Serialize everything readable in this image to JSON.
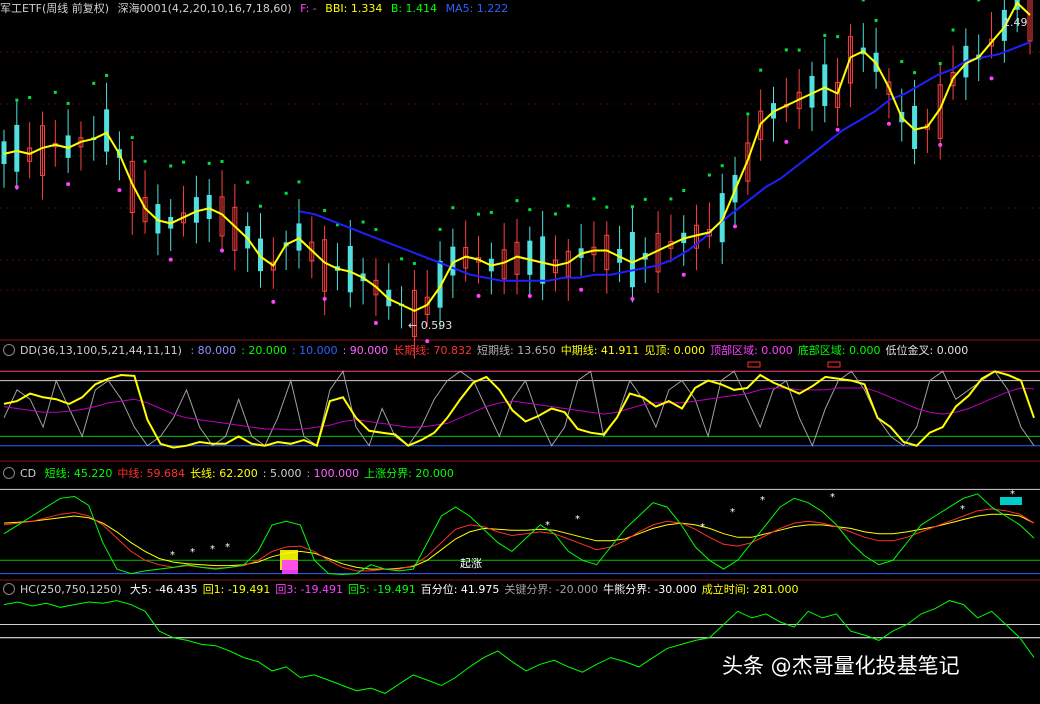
{
  "main": {
    "title": "军工ETF(周线 前复权)",
    "indicator": "深海0001(4,2,20,10,16,7,18,60)",
    "f": "F: -",
    "bbi": "BBI: 1.334",
    "b": "B: 1.414",
    "ma5": "MA5: 1.222",
    "high_label": "1.49",
    "low_label": "0.593"
  },
  "dd": {
    "name": "DD(36,13,100,5,21,44,11,11)",
    "items": [
      {
        "text": ": 80.000",
        "color": "#9090ff"
      },
      {
        "text": ": 20.000",
        "color": "#00ff00"
      },
      {
        "text": ": 10.000",
        "color": "#3060ff"
      },
      {
        "text": ": 90.000",
        "color": "#ff60ff"
      },
      {
        "text": "长期线: 70.832",
        "color": "#ff3030"
      },
      {
        "text": "短期线: 13.650",
        "color": "#b0b0b0"
      },
      {
        "text": "中期线: 41.911",
        "color": "#ffff00"
      },
      {
        "text": "见顶: 0.000",
        "color": "#ffff00"
      },
      {
        "text": "顶部区域: 0.000",
        "color": "#ff40ff"
      },
      {
        "text": "底部区域: 0.000",
        "color": "#00ff00"
      },
      {
        "text": "低位金叉: 0.000",
        "color": "#e0e0e0"
      }
    ]
  },
  "cd": {
    "name": "CD",
    "items": [
      {
        "text": "短线: 45.220",
        "color": "#00ff00"
      },
      {
        "text": "中线: 59.684",
        "color": "#ff3030"
      },
      {
        "text": "长线: 62.200",
        "color": "#ffff00"
      },
      {
        "text": ": 5.000",
        "color": "#d0d0d0"
      },
      {
        "text": ": 100.000",
        "color": "#ff60ff"
      },
      {
        "text": "上涨分界: 20.000",
        "color": "#00ff00"
      }
    ],
    "label": "起涨"
  },
  "hc": {
    "name": "HC(250,750,1250)",
    "items": [
      {
        "text": "大5: -46.435",
        "color": "#ffffff"
      },
      {
        "text": "回1: -19.491",
        "color": "#ffff00"
      },
      {
        "text": "回3: -19.491",
        "color": "#ff40ff"
      },
      {
        "text": "回5: -19.491",
        "color": "#00ff00"
      },
      {
        "text": "百分位: 41.975",
        "color": "#ffffff"
      },
      {
        "text": "关键分界: -20.000",
        "color": "#a0a0a0"
      },
      {
        "text": "牛熊分界: -30.000",
        "color": "#ffffff"
      },
      {
        "text": "成立时间: 281.000",
        "color": "#ffff00"
      }
    ]
  },
  "watermark": "头条 @杰哥量化投基笔记",
  "chart_data": [
    {
      "type": "line",
      "title": "军工ETF(周线 前复权)",
      "series": [
        {
          "name": "BBI",
          "color": "#ffff00",
          "values": [
            1.1,
            1.11,
            1.1,
            1.12,
            1.13,
            1.12,
            1.14,
            1.15,
            1.17,
            1.1,
            1.0,
            0.92,
            0.88,
            0.87,
            0.89,
            0.91,
            0.92,
            0.9,
            0.86,
            0.82,
            0.76,
            0.73,
            0.8,
            0.82,
            0.78,
            0.74,
            0.72,
            0.71,
            0.69,
            0.66,
            0.62,
            0.6,
            0.58,
            0.6,
            0.66,
            0.74,
            0.76,
            0.75,
            0.73,
            0.74,
            0.76,
            0.75,
            0.74,
            0.73,
            0.74,
            0.77,
            0.78,
            0.78,
            0.76,
            0.74,
            0.76,
            0.78,
            0.8,
            0.82,
            0.83,
            0.84,
            0.88,
            0.98,
            1.08,
            1.2,
            1.24,
            1.26,
            1.28,
            1.3,
            1.32,
            1.3,
            1.42,
            1.44,
            1.4,
            1.32,
            1.22,
            1.18,
            1.19,
            1.25,
            1.35,
            1.4,
            1.42,
            1.47,
            1.52,
            1.6,
            1.56
          ]
        },
        {
          "name": "B",
          "color": "#2020ff",
          "values": [
            null,
            null,
            null,
            null,
            null,
            null,
            null,
            null,
            null,
            null,
            null,
            null,
            null,
            null,
            null,
            null,
            null,
            null,
            null,
            0.91,
            0.9,
            0.88,
            0.86,
            0.84,
            0.82,
            0.8,
            0.78,
            0.76,
            0.74,
            0.72,
            0.7,
            0.69,
            0.68,
            0.68,
            0.68,
            0.68,
            0.69,
            0.69,
            0.7,
            0.7,
            0.71,
            0.72,
            0.73,
            0.75,
            0.78,
            0.82,
            0.87,
            0.91,
            0.95,
            0.99,
            1.02,
            1.06,
            1.1,
            1.14,
            1.18,
            1.21,
            1.24,
            1.28,
            1.3,
            1.33,
            1.36,
            1.38,
            1.41,
            1.42,
            1.43,
            1.45,
            1.47
          ]
        }
      ],
      "low": 0.593,
      "high": 1.49
    },
    {
      "type": "line",
      "title": "DD(36,13,100,5,21,44,11,11)",
      "reference_lines": [
        80,
        90,
        20,
        10
      ],
      "series": [
        {
          "name": "中期线",
          "color": "#ffff00",
          "values": [
            55,
            58,
            66,
            62,
            60,
            55,
            62,
            76,
            82,
            86,
            85,
            38,
            12,
            8,
            10,
            14,
            12,
            12,
            20,
            12,
            10,
            14,
            12,
            16,
            10,
            58,
            62,
            40,
            26,
            24,
            22,
            10,
            16,
            24,
            40,
            60,
            78,
            84,
            70,
            48,
            36,
            42,
            50,
            46,
            28,
            24,
            22,
            40,
            66,
            62,
            52,
            58,
            50,
            72,
            80,
            76,
            70,
            72,
            86,
            78,
            72,
            66,
            74,
            84,
            82,
            80,
            76,
            40,
            30,
            14,
            10,
            24,
            30,
            52,
            64,
            82,
            90,
            86,
            80,
            40
          ]
        },
        {
          "name": "长期线",
          "color": "#c000c0",
          "values": [
            52,
            50,
            48,
            46,
            46,
            47,
            49,
            52,
            56,
            58,
            60,
            56,
            50,
            44,
            40,
            38,
            36,
            34,
            32,
            30,
            28,
            28,
            27,
            28,
            30,
            32,
            36,
            38,
            36,
            34,
            32,
            30,
            30,
            32,
            34,
            40,
            46,
            52,
            56,
            58,
            56,
            54,
            52,
            50,
            48,
            46,
            44,
            46,
            50,
            54,
            56,
            56,
            56,
            58,
            60,
            62,
            64,
            66,
            70,
            72,
            72,
            70,
            70,
            70,
            72,
            72,
            72,
            68,
            62,
            56,
            50,
            46,
            44,
            46,
            50,
            56,
            62,
            68,
            72,
            71
          ]
        },
        {
          "name": "短期线",
          "color": "#a0a0a0",
          "values": [
            40,
            70,
            60,
            30,
            80,
            50,
            20,
            70,
            80,
            60,
            30,
            10,
            20,
            40,
            70,
            30,
            10,
            20,
            60,
            20,
            10,
            40,
            80,
            20,
            10,
            70,
            90,
            30,
            10,
            50,
            20,
            10,
            30,
            60,
            80,
            90,
            80,
            50,
            20,
            60,
            80,
            40,
            10,
            30,
            80,
            90,
            20,
            40,
            80,
            60,
            30,
            70,
            80,
            60,
            20,
            80,
            90,
            60,
            30,
            70,
            80,
            40,
            10,
            50,
            80,
            90,
            70,
            40,
            20,
            10,
            30,
            80,
            90,
            60,
            70,
            80,
            90,
            70,
            30,
            10
          ]
        }
      ]
    },
    {
      "type": "line",
      "title": "CD",
      "reference_lines": [
        100,
        20,
        5
      ],
      "series": [
        {
          "name": "短线",
          "color": "#00ff00",
          "values": [
            50,
            60,
            70,
            80,
            90,
            92,
            82,
            40,
            10,
            5,
            8,
            10,
            12,
            15,
            12,
            10,
            12,
            15,
            30,
            60,
            64,
            60,
            20,
            5,
            4,
            5,
            15,
            10,
            8,
            10,
            40,
            70,
            80,
            70,
            55,
            40,
            30,
            45,
            60,
            50,
            30,
            20,
            15,
            35,
            55,
            70,
            85,
            80,
            60,
            35,
            20,
            10,
            20,
            40,
            60,
            80,
            90,
            85,
            75,
            60,
            40,
            25,
            15,
            20,
            40,
            60,
            70,
            80,
            90,
            95,
            80,
            70,
            60,
            45
          ]
        },
        {
          "name": "中线",
          "color": "#ff3030",
          "values": [
            60,
            62,
            64,
            68,
            72,
            74,
            70,
            60,
            45,
            30,
            20,
            15,
            12,
            14,
            12,
            11,
            12,
            14,
            20,
            30,
            35,
            36,
            30,
            20,
            12,
            8,
            8,
            10,
            10,
            14,
            25,
            40,
            55,
            60,
            58,
            52,
            48,
            50,
            52,
            50,
            44,
            38,
            32,
            35,
            42,
            52,
            60,
            64,
            62,
            55,
            46,
            38,
            36,
            40,
            48,
            56,
            62,
            64,
            62,
            58,
            52,
            46,
            42,
            42,
            46,
            52,
            58,
            64,
            70,
            76,
            78,
            76,
            72,
            62
          ]
        },
        {
          "name": "长线",
          "color": "#ffff00",
          "values": [
            62,
            63,
            64,
            66,
            68,
            70,
            68,
            62,
            52,
            40,
            30,
            22,
            18,
            16,
            15,
            14,
            14,
            15,
            18,
            24,
            28,
            30,
            28,
            22,
            16,
            12,
            10,
            10,
            11,
            13,
            20,
            32,
            44,
            52,
            56,
            55,
            54,
            54,
            55,
            54,
            50,
            46,
            42,
            42,
            44,
            50,
            56,
            60,
            62,
            60,
            56,
            50,
            46,
            46,
            50,
            54,
            58,
            60,
            60,
            58,
            56,
            52,
            50,
            50,
            52,
            55,
            58,
            62,
            66,
            70,
            72,
            72,
            70,
            62
          ]
        }
      ]
    },
    {
      "type": "line",
      "title": "HC(250,750,1250)",
      "reference_lines": [
        -20,
        -30
      ],
      "series": [
        {
          "name": "大5",
          "color": "#00ff00",
          "values": [
            -5,
            -3,
            -6,
            -4,
            -7,
            -5,
            -3,
            -4,
            -2,
            -5,
            -10,
            -25,
            -30,
            -32,
            -35,
            -36,
            -40,
            -45,
            -48,
            -55,
            -52,
            -60,
            -58,
            -62,
            -66,
            -70,
            -68,
            -72,
            -65,
            -58,
            -62,
            -66,
            -60,
            -52,
            -45,
            -40,
            -48,
            -55,
            -50,
            -47,
            -52,
            -56,
            -50,
            -45,
            -48,
            -52,
            -45,
            -38,
            -35,
            -32,
            -30,
            -20,
            -10,
            -15,
            -12,
            -18,
            -22,
            -10,
            -15,
            -12,
            -25,
            -28,
            -32,
            -25,
            -20,
            -12,
            -8,
            -2,
            -5,
            -15,
            -10,
            -20,
            -30,
            -45
          ]
        }
      ]
    }
  ]
}
